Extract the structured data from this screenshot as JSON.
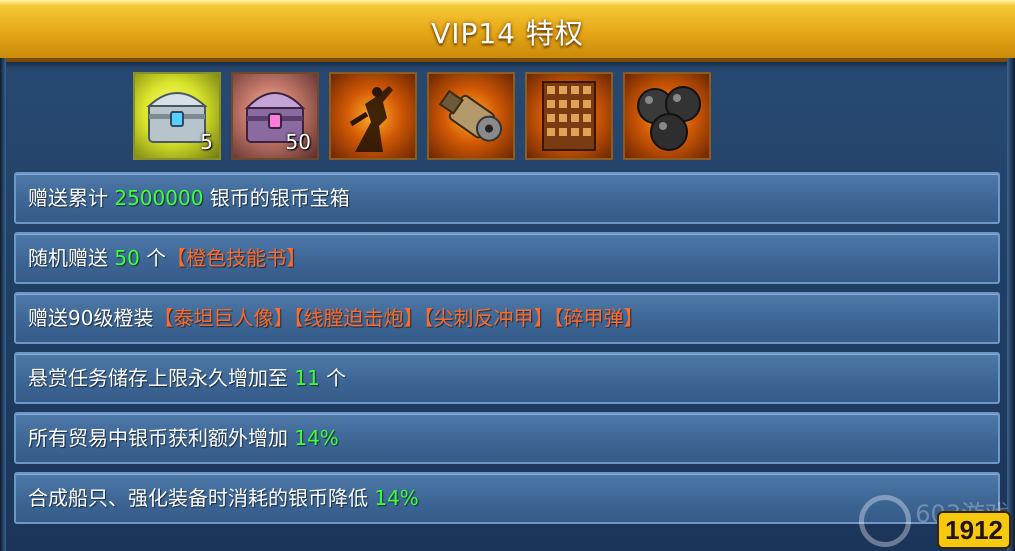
{
  "header": {
    "title": "VIP14 特权"
  },
  "rewards": [
    {
      "icon": "silver-chest-icon",
      "count": "5"
    },
    {
      "icon": "purple-chest-icon",
      "count": "50"
    },
    {
      "icon": "titan-statue-icon",
      "count": ""
    },
    {
      "icon": "gatling-cannon-icon",
      "count": ""
    },
    {
      "icon": "spiked-armor-icon",
      "count": ""
    },
    {
      "icon": "armor-piercing-shells-icon",
      "count": ""
    }
  ],
  "privileges": [
    {
      "pre": "赠送累计 ",
      "value": "2500000",
      "post": " 银币的银币宝箱"
    },
    {
      "pre": "随机赠送 ",
      "value": "50",
      "mid": " 个",
      "item": "【橙色技能书】"
    },
    {
      "pre": "赠送90级橙装",
      "items": [
        "【泰坦巨人像】",
        "【线膛迫击炮】",
        "【尖刺反冲甲】",
        "【碎甲弹】"
      ]
    },
    {
      "pre": "悬赏任务储存上限永久增加至 ",
      "value": "11",
      "post": " 个"
    },
    {
      "pre": "所有贸易中银币获利额外增加 ",
      "value": "14%"
    },
    {
      "pre": "合成船只、强化装备时消耗的银币降低 ",
      "value": "14%"
    }
  ],
  "watermark": {
    "text": "603游戏",
    "logo": "1912"
  },
  "colors": {
    "highlight": "#3cff3c",
    "item": "#ff6a2a",
    "title_bar": "#e6a817"
  }
}
